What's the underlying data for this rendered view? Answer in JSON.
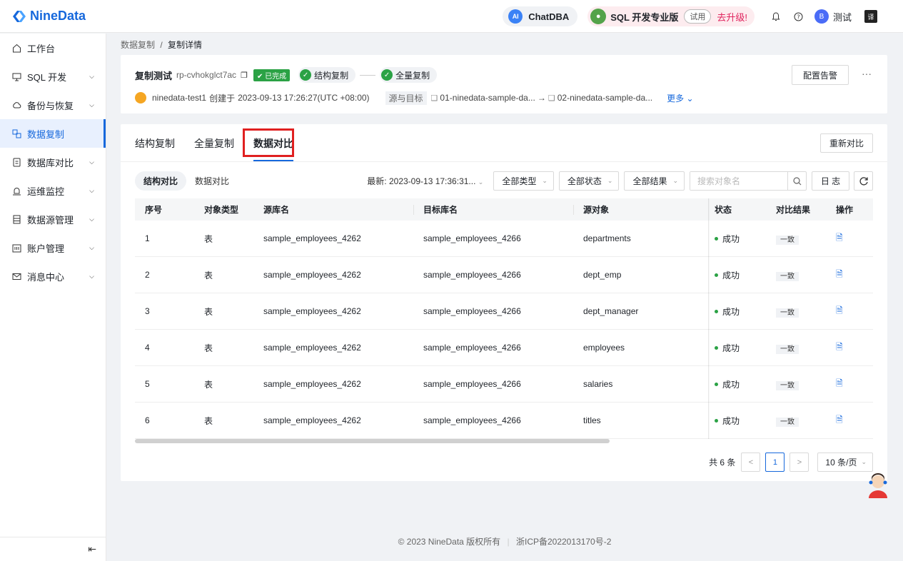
{
  "app": {
    "brand": "NineData"
  },
  "topbar": {
    "chatdba": {
      "badge": "AI",
      "label": "ChatDBA"
    },
    "sqlpro": {
      "label": "SQL 开发专业版",
      "trial": "试用",
      "upgrade": "去升级!"
    },
    "user": {
      "avatar": "B",
      "name": "测试"
    },
    "lang": "译"
  },
  "sidebar": {
    "items": [
      {
        "label": "工作台",
        "icon": "home-icon"
      },
      {
        "label": "SQL 开发",
        "icon": "monitor-icon"
      },
      {
        "label": "备份与恢复",
        "icon": "cloud-icon"
      },
      {
        "label": "数据复制",
        "icon": "copy-icon"
      },
      {
        "label": "数据库对比",
        "icon": "document-icon"
      },
      {
        "label": "运维监控",
        "icon": "alarm-icon"
      },
      {
        "label": "数据源管理",
        "icon": "database-icon"
      },
      {
        "label": "账户管理",
        "icon": "account-icon"
      },
      {
        "label": "消息中心",
        "icon": "mail-icon"
      }
    ]
  },
  "breadcrumb": {
    "parent": "数据复制",
    "sep": "/",
    "current": "复制详情"
  },
  "replication": {
    "name": "复制测试",
    "id": "rp-cvhokglct7ac",
    "status": "已完成",
    "stages": [
      "结构复制",
      "全量复制"
    ],
    "owner": "ninedata-test1",
    "created_prefix": "创建于",
    "created": "2023-09-13 17:26:27(UTC +08:00)",
    "src_tgt_label": "源与目标",
    "source": "01-ninedata-sample-da...",
    "arrow": "→",
    "target": "02-ninedata-sample-da...",
    "more": "更多",
    "alarm_button": "配置告警"
  },
  "tabs": [
    "结构复制",
    "全量复制",
    "数据对比"
  ],
  "active_tab": "数据对比",
  "recompare_button": "重新对比",
  "subtabs": [
    "结构对比",
    "数据对比"
  ],
  "filters": {
    "latest_label": "最新:",
    "latest_value": "2023-09-13 17:36:31...",
    "type": "全部类型",
    "status": "全部状态",
    "result": "全部结果",
    "search_placeholder": "搜索对象名",
    "log_button": "日 志"
  },
  "table": {
    "columns": [
      "序号",
      "对象类型",
      "源库名",
      "目标库名",
      "源对象",
      "状态",
      "对比结果",
      "操作"
    ],
    "rows": [
      {
        "no": "1",
        "type": "表",
        "src_db": "sample_employees_4262",
        "tgt_db": "sample_employees_4266",
        "src_obj": "departments",
        "status": "成功",
        "result": "一致"
      },
      {
        "no": "2",
        "type": "表",
        "src_db": "sample_employees_4262",
        "tgt_db": "sample_employees_4266",
        "src_obj": "dept_emp",
        "status": "成功",
        "result": "一致"
      },
      {
        "no": "3",
        "type": "表",
        "src_db": "sample_employees_4262",
        "tgt_db": "sample_employees_4266",
        "src_obj": "dept_manager",
        "status": "成功",
        "result": "一致"
      },
      {
        "no": "4",
        "type": "表",
        "src_db": "sample_employees_4262",
        "tgt_db": "sample_employees_4266",
        "src_obj": "employees",
        "status": "成功",
        "result": "一致"
      },
      {
        "no": "5",
        "type": "表",
        "src_db": "sample_employees_4262",
        "tgt_db": "sample_employees_4266",
        "src_obj": "salaries",
        "status": "成功",
        "result": "一致"
      },
      {
        "no": "6",
        "type": "表",
        "src_db": "sample_employees_4262",
        "tgt_db": "sample_employees_4266",
        "src_obj": "titles",
        "status": "成功",
        "result": "一致"
      }
    ]
  },
  "pagination": {
    "total": "共 6 条",
    "current": "1",
    "page_size": "10 条/页"
  },
  "footer": {
    "copyright": "© 2023 NineData 版权所有",
    "icp": "浙ICP备2022013170号-2"
  },
  "colors": {
    "accent": "#1668dc",
    "success": "#2ba245",
    "highlight": "#e02020"
  }
}
